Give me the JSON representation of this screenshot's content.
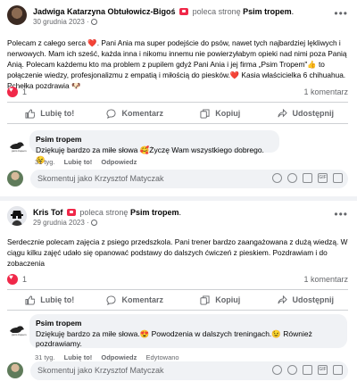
{
  "posts": [
    {
      "author": "Jadwiga Katarzyna Obtułowicz-Bigoś",
      "recommends_text": "poleca stronę",
      "page": "Psim tropem",
      "date": "30 grudnia 2023",
      "text": "Polecam z całego serca ❤️. Pani Ania ma super podejście do psów, nawet tych najbardziej lękliwych i nerwowych. Mam ich sześć, każda inna i nikomu innemu nie powierzyłabym opieki nad nimi poza Panią Anią. Polecam każdemu kto ma problem z pupilem gdyż Pani Ania i jej firma „Psim Tropem\"👍 to połączenie wiedzy, profesjonalizmu z empatią i miłością do piesków.❤️ Kasia właścicielka 6 chihuahua. Pchełka pozdrawia 🐶",
      "likes": "1",
      "comments": "1 komentarz",
      "comment": {
        "author": "Psim tropem",
        "text": "Dziękuję bardzo za miłe słowa 🥰Życzę Wam wszystkiego dobrego.😉",
        "age": "31 tyg.",
        "like": "Lubię to!",
        "reply": "Odpowiedz",
        "edited": ""
      }
    },
    {
      "author": "Kris Tof",
      "recommends_text": "poleca stronę",
      "page": "Psim tropem",
      "date": "29 grudnia 2023",
      "text": "Serdecznie polecam zajęcia z psiego przedszkola. Pani trener bardzo zaangażowana z dużą wiedzą. W ciągu kilku zajęć udało się opanować podstawy do dalszych ćwiczeń z pieskiem. Pozdrawiam i do zobaczenia",
      "likes": "1",
      "comments": "1 komentarz",
      "comment": {
        "author": "Psim tropem",
        "text": "Dziękuję bardzo za miłe słowa.😍 Powodzenia w dalszych treningach.😉 Również pozdrawiamy.",
        "age": "31 tyg.",
        "like": "Lubię to!",
        "reply": "Odpowiedz",
        "edited": "Edytowano"
      }
    }
  ],
  "actions": {
    "like": "Lubię to!",
    "comment": "Komentarz",
    "copy": "Kopiuj",
    "share": "Udostępnij"
  },
  "compose_placeholder": "Skomentuj jako Krzysztof Matyczak",
  "colors": {
    "recommend": "#f02849",
    "muted": "#65676b",
    "surface": "#f0f2f5"
  }
}
